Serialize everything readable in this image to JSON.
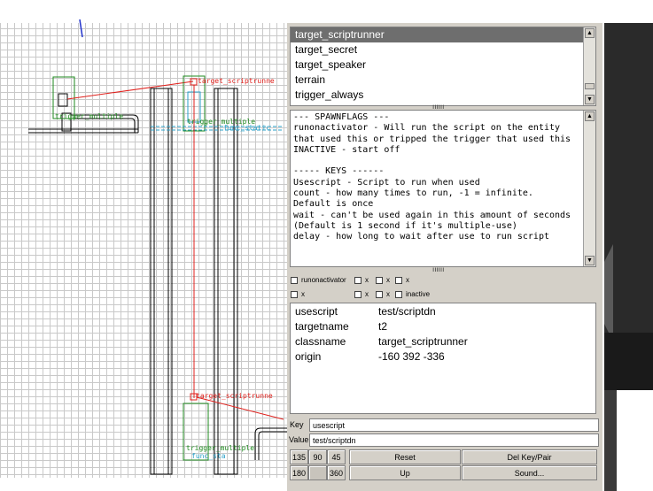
{
  "viewport": {
    "labels": {
      "trigger_multiple_left": "trigger_multiple",
      "target_scriptrunner_top": "target_scriptrunne",
      "trigger_multiple_mid": "trigger_multiple",
      "func_static": "func_static",
      "target_scriptrunner_bottom": "target_scriptrunne",
      "trigger_multiple_bottom": "trigger_multiple",
      "func_bottom": "func_sta"
    }
  },
  "entity_list": {
    "items": [
      "target_scriptrunner",
      "target_secret",
      "target_speaker",
      "terrain",
      "trigger_always"
    ],
    "selected_index": 0
  },
  "description": "--- SPAWNFLAGS ---\nrunonactivator - Will run the script on the entity\nthat used this or tripped the trigger that used this\nINACTIVE - start off\n\n----- KEYS ------\nUsescript - Script to run when used\ncount - how many times to run, -1 = infinite.\nDefault is once\nwait - can't be used again in this amount of seconds\n(Default is 1 second if it's multiple-use)\ndelay - how long to wait after use to run script",
  "spawnflags": {
    "row1": [
      "runonactivator",
      "x",
      "x",
      "x"
    ],
    "row2": [
      "x",
      "x",
      "x",
      "inactive"
    ]
  },
  "keyvalues": [
    {
      "key": "usescript",
      "value": "test/scriptdn"
    },
    {
      "key": "targetname",
      "value": "t2"
    },
    {
      "key": "classname",
      "value": "target_scriptrunner"
    },
    {
      "key": "origin",
      "value": "-160 392 -336"
    }
  ],
  "key_field": {
    "label": "Key",
    "value": "usescript"
  },
  "value_field": {
    "label": "Value",
    "value": "test/scriptdn"
  },
  "buttons": {
    "angle_135": "135",
    "angle_90": "90",
    "angle_45": "45",
    "angle_180": "180",
    "angle_360": "360",
    "reset": "Reset",
    "del_key_pair": "Del Key/Pair",
    "up": "Up",
    "sound": "Sound..."
  },
  "colors": {
    "entity_red": "#e0201c",
    "trigger_green": "#1f8a1f",
    "func_cyan": "#2aa0c8",
    "selection_gray": "#6e6e6e"
  }
}
